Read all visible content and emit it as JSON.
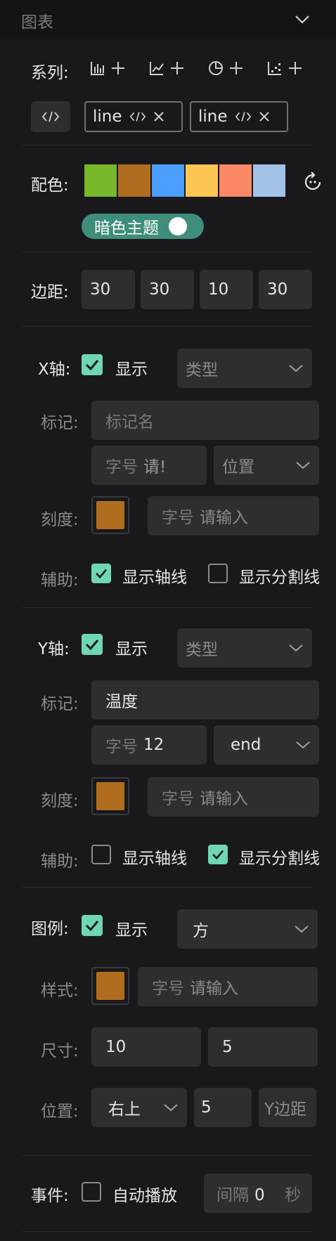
{
  "header": {
    "title": "图表"
  },
  "series": {
    "label": "系列:",
    "tags": [
      {
        "label": "line"
      },
      {
        "label": "line"
      }
    ]
  },
  "colors": {
    "label": "配色:",
    "palette": [
      "#76b82a",
      "#b06d1f",
      "#4a9eff",
      "#fcc451",
      "#fb8866",
      "#a3c2e8"
    ],
    "dark_theme_label": "暗色主题"
  },
  "margin": {
    "label": "边距:",
    "values": [
      "30",
      "30",
      "10",
      "30"
    ]
  },
  "xaxis": {
    "label": "X轴:",
    "show_label": "显示",
    "type_placeholder": "类型",
    "mark_label": "标记:",
    "mark_name_placeholder": "标记名",
    "mark_font_prefix": "字号",
    "mark_font_placeholder": "请!",
    "mark_position_placeholder": "位置",
    "tick_label": "刻度:",
    "tick_color": "#b06d1f",
    "tick_font_prefix": "字号",
    "tick_font_placeholder": "请输入",
    "aux_label": "辅助:",
    "show_axis_line": "显示轴线",
    "show_split_line": "显示分割线"
  },
  "yaxis": {
    "label": "Y轴:",
    "show_label": "显示",
    "type_placeholder": "类型",
    "mark_label": "标记:",
    "mark_name_value": "温度",
    "mark_font_prefix": "字号",
    "mark_font_value": "12",
    "mark_position_value": "end",
    "tick_label": "刻度:",
    "tick_color": "#b06d1f",
    "tick_font_prefix": "字号",
    "tick_font_placeholder": "请输入",
    "aux_label": "辅助:",
    "show_axis_line": "显示轴线",
    "show_split_line": "显示分割线"
  },
  "legend": {
    "label": "图例:",
    "show_label": "显示",
    "shape_value": "方",
    "style_label": "样式:",
    "style_color": "#b06d1f",
    "font_prefix": "字号",
    "font_placeholder": "请输入",
    "size_label": "尺寸:",
    "width_value": "10",
    "height_value": "5",
    "position_label": "位置:",
    "position_value": "右上",
    "offset_value": "5",
    "margin_button": "Y边距"
  },
  "events": {
    "label": "事件:",
    "autoplay_label": "自动播放",
    "interval_prefix": "间隔",
    "interval_value": "0",
    "interval_unit": "秒"
  }
}
